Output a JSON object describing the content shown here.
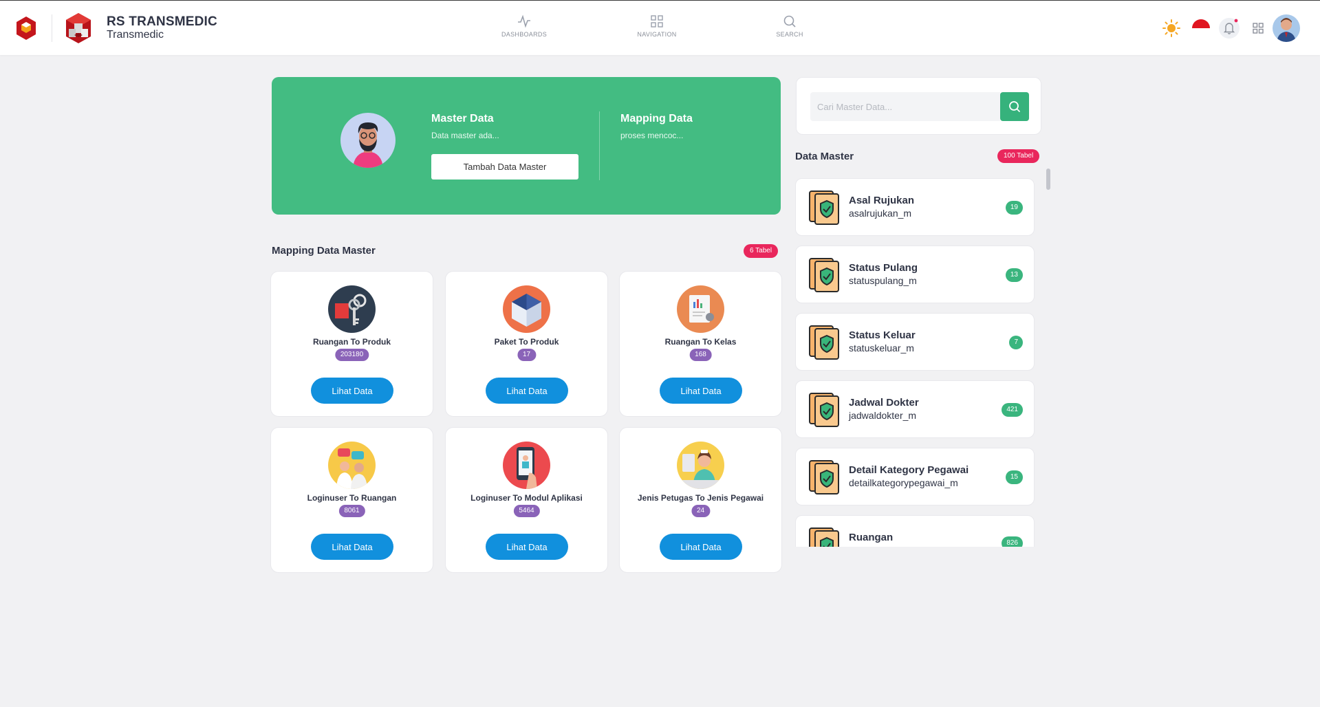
{
  "colors": {
    "primary_green": "#43bc82",
    "button_blue": "#1190dd",
    "badge_pink": "#e9275c",
    "count_purple": "#8a63b8",
    "count_green": "#3ab57e",
    "logo_red": "#c4161c"
  },
  "header": {
    "brand_title": "RS TRANSMEDIC",
    "brand_subtitle": "Transmedic",
    "nav": [
      {
        "label": "DASHBOARDS",
        "icon": "activity-icon"
      },
      {
        "label": "NAVIGATION",
        "icon": "grid-icon"
      },
      {
        "label": "SEARCH",
        "icon": "search-icon"
      }
    ],
    "icons": [
      "sun-icon",
      "flag-indonesia-icon",
      "bell-icon",
      "apps-grid-icon",
      "user-avatar"
    ]
  },
  "hero": {
    "col1_title": "Master Data",
    "col1_desc": "Data master ada...",
    "button_label": "Tambah Data Master",
    "col2_title": "Mapping Data",
    "col2_desc": "proses mencoc..."
  },
  "mapping": {
    "title": "Mapping Data Master",
    "badge": "6 Tabel",
    "button_label": "Lihat Data",
    "cards": [
      {
        "title": "Ruangan To Produk",
        "count": "203180",
        "icon": "key-icon"
      },
      {
        "title": "Paket To Produk",
        "count": "17",
        "icon": "box-icon"
      },
      {
        "title": "Ruangan To Kelas",
        "count": "168",
        "icon": "document-chart-icon"
      },
      {
        "title": "Loginuser To Ruangan",
        "count": "8061",
        "icon": "doctors-icon"
      },
      {
        "title": "Loginuser To Modul Aplikasi",
        "count": "5464",
        "icon": "phone-doctor-icon"
      },
      {
        "title": "Jenis Petugas To Jenis Pegawai",
        "count": "24",
        "icon": "nurse-icon"
      }
    ]
  },
  "search": {
    "placeholder": "Cari Master Data..."
  },
  "data_master": {
    "title": "Data Master",
    "badge": "100 Tabel",
    "items": [
      {
        "title": "Asal Rujukan",
        "table": "asalrujukan_m",
        "count": "19"
      },
      {
        "title": "Status Pulang",
        "table": "statuspulang_m",
        "count": "13"
      },
      {
        "title": "Status Keluar",
        "table": "statuskeluar_m",
        "count": "7"
      },
      {
        "title": "Jadwal Dokter",
        "table": "jadwaldokter_m",
        "count": "421"
      },
      {
        "title": "Detail Kategory Pegawai",
        "table": "detailkategorypegawai_m",
        "count": "15"
      },
      {
        "title": "Ruangan",
        "table": "",
        "count": "826"
      }
    ]
  }
}
